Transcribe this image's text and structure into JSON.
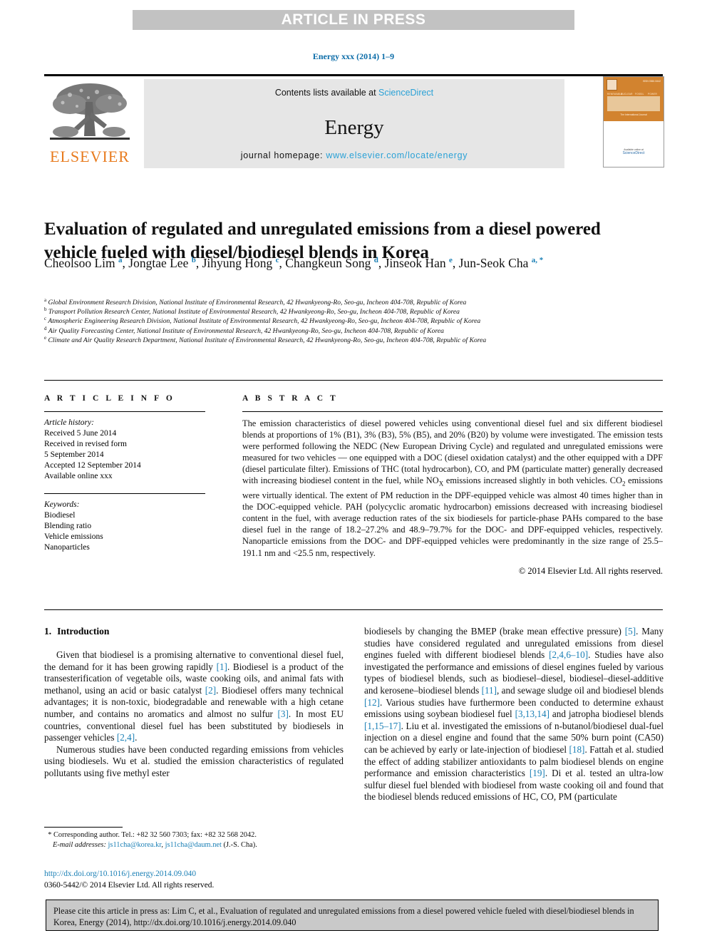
{
  "banner": {
    "text": "ARTICLE IN PRESS"
  },
  "running_head": {
    "text": "Energy xxx (2014) 1–9"
  },
  "masthead": {
    "contents_prefix": "Contents lists available at ",
    "sciencedirect": "ScienceDirect",
    "journal_name": "Energy",
    "homepage_prefix": "journal homepage: ",
    "homepage_url": "www.elsevier.com/locate/energy",
    "publisher": "ELSEVIER",
    "cover": {
      "title": "ENERGY",
      "subtitle": "The International Journal",
      "keywords": [
        "RENEWABLE",
        "NUCLEAR",
        "FOSSIL",
        "POWER"
      ],
      "footer_line1": "Available online at",
      "footer_line2": "ScienceDirect",
      "corner_note": "ISSN 0360-5442"
    }
  },
  "article": {
    "title": "Evaluation of regulated and unregulated emissions from a diesel powered vehicle fueled with diesel/biodiesel blends in Korea",
    "authors": [
      {
        "name": "Cheolsoo Lim",
        "marks": "a"
      },
      {
        "name": "Jongtae Lee",
        "marks": "b"
      },
      {
        "name": "Jihyung Hong",
        "marks": "c"
      },
      {
        "name": "Changkeun Song",
        "marks": "d"
      },
      {
        "name": "Jinseok Han",
        "marks": "e"
      },
      {
        "name": "Jun-Seok Cha",
        "marks": "a, *"
      }
    ],
    "affiliations": [
      {
        "mark": "a",
        "text": "Global Environment Research Division, National Institute of Environmental Research, 42 Hwankyeong-Ro, Seo-gu, Incheon 404-708, Republic of Korea"
      },
      {
        "mark": "b",
        "text": "Transport Pollution Research Center, National Institute of Environmental Research, 42 Hwankyeong-Ro, Seo-gu, Incheon 404-708, Republic of Korea"
      },
      {
        "mark": "c",
        "text": "Atmospheric Engineering Research Division, National Institute of Environmental Research, 42 Hwankyeong-Ro, Seo-gu, Incheon 404-708, Republic of Korea"
      },
      {
        "mark": "d",
        "text": "Air Quality Forecasting Center, National Institute of Environmental Research, 42 Hwankyeong-Ro, Seo-gu, Incheon 404-708, Republic of Korea"
      },
      {
        "mark": "e",
        "text": "Climate and Air Quality Research Department, National Institute of Environmental Research, 42 Hwankyeong-Ro, Seo-gu, Incheon 404-708, Republic of Korea"
      }
    ]
  },
  "article_info": {
    "heading": "A R T I C L E   I N F O",
    "history_label": "Article history:",
    "history": [
      "Received 5 June 2014",
      "Received in revised form",
      "5 September 2014",
      "Accepted 12 September 2014",
      "Available online xxx"
    ],
    "keywords_label": "Keywords:",
    "keywords": [
      "Biodiesel",
      "Blending ratio",
      "Vehicle emissions",
      "Nanoparticles"
    ]
  },
  "abstract": {
    "heading": "A B S T R A C T",
    "body_1": "The emission characteristics of diesel powered vehicles using conventional diesel fuel and six different biodiesel blends at proportions of 1% (B1), 3% (B3), 5% (B5), and 20% (B20) by volume were investigated. The emission tests were performed following the NEDC (New European Driving Cycle) and regulated and unregulated emissions were measured for two vehicles — one equipped with a DOC (diesel oxidation catalyst) and the other equipped with a DPF (diesel particulate filter). Emissions of THC (total hydrocarbon), CO, and PM (particulate matter) generally decreased with increasing biodiesel content in the fuel, while NO",
    "body_nox_sub": "X",
    "body_2": " emissions increased slightly in both vehicles. CO",
    "body_co2_sub": "2",
    "body_3": " emissions were virtually identical. The extent of PM reduction in the DPF-equipped vehicle was almost 40 times higher than in the DOC-equipped vehicle. PAH (polycyclic aromatic hydrocarbon) emissions decreased with increasing biodiesel content in the fuel, with average reduction rates of the six biodiesels for particle-phase PAHs compared to the base diesel fuel in the range of 18.2–27.2% and 48.9–79.7% for the DOC- and DPF-equipped vehicles, respectively. Nanoparticle emissions from the DOC- and DPF-equipped vehicles were predominantly in the size range of 25.5–191.1 nm and <25.5 nm, respectively.",
    "copyright": "© 2014 Elsevier Ltd. All rights reserved."
  },
  "intro": {
    "number": "1.",
    "heading": "Introduction",
    "left_p1_a": "Given that biodiesel is a promising alternative to conventional diesel fuel, the demand for it has been growing rapidly ",
    "left_p1_r1": "[1]",
    "left_p1_b": ". Biodiesel is a product of the transesterification of vegetable oils, waste cooking oils, and animal fats with methanol, using an acid or basic catalyst ",
    "left_p1_r2": "[2]",
    "left_p1_c": ". Biodiesel offers many technical advantages; it is non-toxic, biodegradable and renewable with a high cetane number, and contains no aromatics and almost no sulfur ",
    "left_p1_r3": "[3]",
    "left_p1_d": ". In most EU countries, conventional diesel fuel has been substituted by biodiesels in passenger vehicles ",
    "left_p1_r4": "[2,4]",
    "left_p1_e": ".",
    "left_p2": "Numerous studies have been conducted regarding emissions from vehicles using biodiesels. Wu et al. studied the emission characteristics of regulated pollutants using five methyl ester",
    "right_p1_a": "biodiesels by changing the BMEP (brake mean effective pressure) ",
    "right_p1_r1": "[5]",
    "right_p1_b": ". Many studies have considered regulated and unregulated emissions from diesel engines fueled with different biodiesel blends ",
    "right_p1_r2": "[2,4,6–10]",
    "right_p1_c": ". Studies have also investigated the performance and emissions of diesel engines fueled by various types of biodiesel blends, such as biodiesel–diesel, biodiesel–diesel-additive and kerosene–biodiesel blends ",
    "right_p1_r3": "[11]",
    "right_p1_d": ", and sewage sludge oil and biodiesel blends ",
    "right_p1_r4": "[12]",
    "right_p1_e": ". Various studies have furthermore been conducted to determine exhaust emissions using soybean biodiesel fuel ",
    "right_p1_r5": "[3,13,14]",
    "right_p1_f": " and jatropha biodiesel blends ",
    "right_p1_r6": "[1,15–17]",
    "right_p1_g": ". Liu et al. investigated the emissions of n-butanol/biodiesel dual-fuel injection on a diesel engine and found that the same 50% burn point (CA50) can be achieved by early or late-injection of biodiesel ",
    "right_p1_r7": "[18]",
    "right_p1_h": ". Fattah et al. studied the effect of adding stabilizer antioxidants to palm biodiesel blends on engine performance and emission characteristics ",
    "right_p1_r8": "[19]",
    "right_p1_i": ". Di et al. tested an ultra-low sulfur diesel fuel blended with biodiesel from waste cooking oil and found that the biodiesel blends reduced emissions of HC, CO, PM (particulate"
  },
  "footnote": {
    "star": "*",
    "corresponding": " Corresponding author. Tel.: +82 32 560 7303; fax: +82 32 568 2042.",
    "email_label": "E-mail addresses:",
    "email_1": "js11cha@korea.kr",
    "email_sep": ", ",
    "email_2": "js11cha@daum.net",
    "email_suffix": " (J.-S. Cha).",
    "doi": "http://dx.doi.org/10.1016/j.energy.2014.09.040",
    "issn_line": "0360-5442/© 2014 Elsevier Ltd. All rights reserved."
  },
  "cite_box": {
    "text": "Please cite this article in press as: Lim C, et al., Evaluation of regulated and unregulated emissions from a diesel powered vehicle fueled with diesel/biodiesel blends in Korea, Energy (2014), http://dx.doi.org/10.1016/j.energy.2014.09.040"
  },
  "colors": {
    "link": "#1a7fb5",
    "banner_bg": "#c2c2c2",
    "band_bg": "#e6e6e6",
    "elsevier_orange": "#e87b1e",
    "cite_bg": "#c9c9c9"
  }
}
